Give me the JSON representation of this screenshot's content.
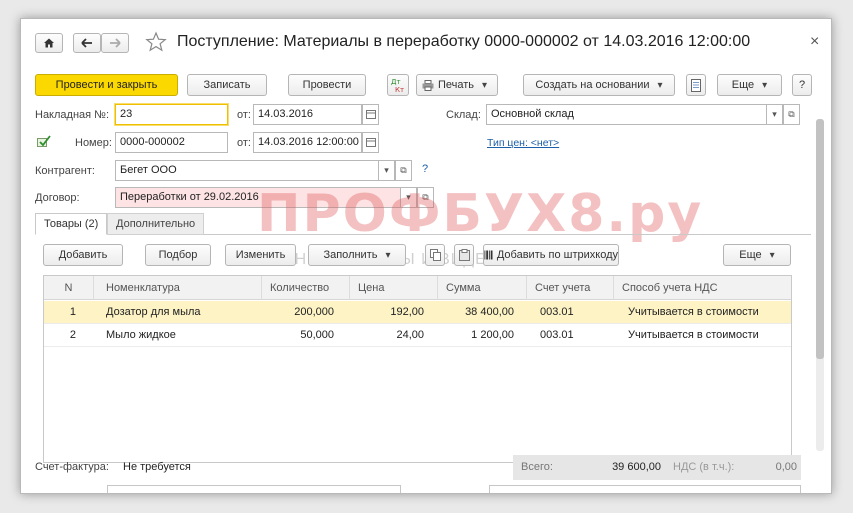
{
  "window": {
    "title": "Поступление: Материалы в переработку 0000-000002 от 14.03.2016 12:00:00",
    "close_glyph": "×"
  },
  "toolbar": {
    "post_close": "Провести и закрыть",
    "save": "Записать",
    "post": "Провести",
    "print": "Печать",
    "create_based": "Создать на основании",
    "more": "Еще",
    "help": "?"
  },
  "header": {
    "invoice_label": "Накладная  №:",
    "invoice_number": "23",
    "from_label": "от:",
    "invoice_date": "14.03.2016",
    "number_label": "Номер:",
    "number_value": "0000-000002",
    "from_label2": "от:",
    "number_datetime": "14.03.2016 12:00:00",
    "warehouse_label": "Склад:",
    "warehouse_value": "Основной склад",
    "price_type_link": "Тип цен: <нет>",
    "counterparty_label": "Контрагент:",
    "counterparty_value": "Бегет ООО",
    "help_mark": "?",
    "contract_label": "Договор:",
    "contract_value": "Переработки от 29.02.2016"
  },
  "watermark": {
    "main": "ПРОФБУХ8.ру",
    "sub": "ОНЛАЙН-СЕМИНАРЫ И ВИДЕОКУРСЫ 1С:8"
  },
  "tabs": [
    {
      "label": "Товары (2)",
      "active": true
    },
    {
      "label": "Дополнительно",
      "active": false
    }
  ],
  "table_toolbar": {
    "add": "Добавить",
    "pick": "Подбор",
    "edit": "Изменить",
    "fill": "Заполнить",
    "barcode": "Добавить по штрихкоду",
    "more": "Еще"
  },
  "table": {
    "columns": [
      "N",
      "Номенклатура",
      "Количество",
      "Цена",
      "Сумма",
      "Счет учета",
      "Способ учета НДС"
    ],
    "rows": [
      [
        "1",
        "Дозатор для мыла",
        "200,000",
        "192,00",
        "38 400,00",
        "003.01",
        "Учитывается в стоимости"
      ],
      [
        "2",
        "Мыло жидкое",
        "50,000",
        "24,00",
        "1 200,00",
        "003.01",
        "Учитывается в стоимости"
      ]
    ]
  },
  "footer": {
    "invoice_label": "Счет-фактура:",
    "invoice_value": "Не требуется",
    "total_label": "Всего:",
    "total_value": "39 600,00",
    "vat_label": "НДС (в т.ч.):",
    "vat_value": "0,00"
  },
  "colors": {
    "primary_button": "#fbd800",
    "selected_row": "#fdf3c5",
    "link": "#1c5ea8",
    "contract_field": "#fde3e3"
  }
}
